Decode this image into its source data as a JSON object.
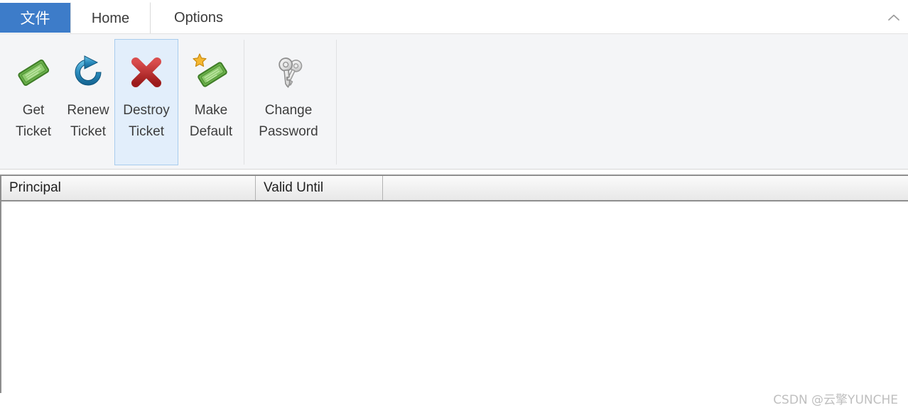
{
  "tabs": [
    {
      "label": "文件",
      "name": "tab-file",
      "state": "app-menu"
    },
    {
      "label": "Home",
      "name": "tab-home",
      "state": "selected"
    },
    {
      "label": "Options",
      "name": "tab-options",
      "state": "normal"
    }
  ],
  "ribbon": {
    "collapse_icon": "chevron-up-icon",
    "buttons": [
      {
        "line1": "Get",
        "line2": "Ticket",
        "icon": "green-ticket-icon",
        "selected": false
      },
      {
        "line1": "Renew",
        "line2": "Ticket",
        "icon": "blue-refresh-icon",
        "selected": false
      },
      {
        "line1": "Destroy",
        "line2": "Ticket",
        "icon": "red-x-icon",
        "selected": true
      },
      {
        "line1": "Make",
        "line2": "Default",
        "icon": "ticket-star-icon",
        "selected": false
      },
      {
        "line1": "Change",
        "line2": "Password",
        "icon": "gray-keys-icon",
        "selected": false
      }
    ]
  },
  "listview": {
    "columns": [
      {
        "label": "Principal"
      },
      {
        "label": "Valid Until"
      },
      {
        "label": ""
      }
    ],
    "rows": []
  },
  "watermark": {
    "text": "CSDN @云擎YUNCHE"
  },
  "colors": {
    "file_tab_blue": "#3d7cc9",
    "ribbon_bg": "#f4f5f7",
    "selection_bg": "#e2eefb",
    "selection_border": "#a8cced",
    "header_bg": "#efefef"
  }
}
